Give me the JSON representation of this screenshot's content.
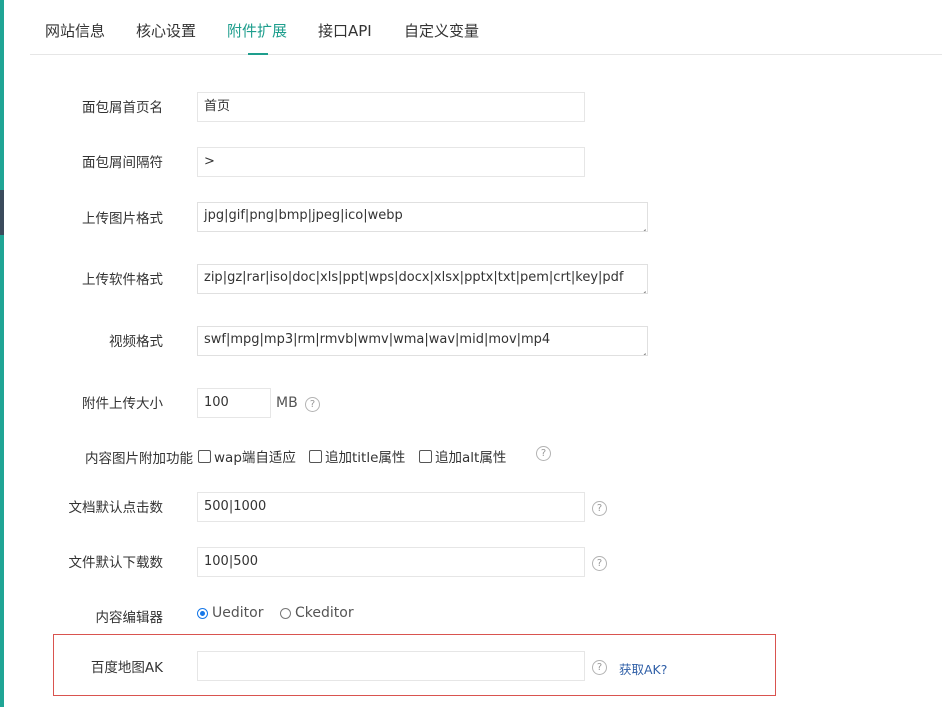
{
  "tabs": [
    {
      "label": "网站信息"
    },
    {
      "label": "核心设置"
    },
    {
      "label": "附件扩展"
    },
    {
      "label": "接口API"
    },
    {
      "label": "自定义变量"
    }
  ],
  "active_tab": "附件扩展",
  "form": {
    "breadcrumb_home": {
      "label": "面包屑首页名",
      "value": "首页"
    },
    "breadcrumb_sep": {
      "label": "面包屑间隔符",
      "value": ">"
    },
    "image_formats": {
      "label": "上传图片格式",
      "value": "jpg|gif|png|bmp|jpeg|ico|webp"
    },
    "software_formats": {
      "label": "上传软件格式",
      "value": "zip|gz|rar|iso|doc|xls|ppt|wps|docx|xlsx|pptx|txt|pem|crt|key|pdf"
    },
    "video_formats": {
      "label": "视频格式",
      "value": "swf|mpg|mp3|rm|rmvb|wmv|wma|wav|mid|mov|mp4"
    },
    "upload_size": {
      "label": "附件上传大小",
      "value": "100",
      "unit": "MB"
    },
    "image_extras": {
      "label": "内容图片附加功能",
      "options": [
        "wap端自适应",
        "追加title属性",
        "追加alt属性"
      ]
    },
    "default_clicks": {
      "label": "文档默认点击数",
      "value": "500|1000"
    },
    "default_downloads": {
      "label": "文件默认下载数",
      "value": "100|500"
    },
    "editor": {
      "label": "内容编辑器",
      "options": [
        "Ueditor",
        "Ckeditor"
      ],
      "selected": "Ueditor"
    },
    "baidu_ak": {
      "label": "百度地图AK",
      "value": "",
      "link": "获取AK?"
    }
  },
  "help_glyph": "?",
  "colors": {
    "accent": "#1e9e8d",
    "highlight_border": "#d9534f",
    "link": "#2f5fa7",
    "radio": "#1677e8"
  }
}
